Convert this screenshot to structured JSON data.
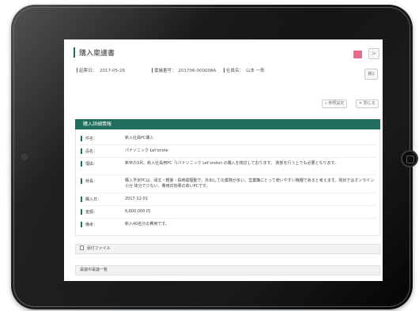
{
  "page": {
    "title": "購入稟議書",
    "meta": [
      {
        "label": "起票日：",
        "value": "2017-05-26"
      },
      {
        "label": "稟議番号：",
        "value": "201706-000008A"
      },
      {
        "label": "社員名：",
        "value": "山本 一郎"
      }
    ],
    "next_label": ">",
    "side_button_label": "我1",
    "tools": {
      "reference_label": "参照設定",
      "close_label": "閉じる"
    }
  },
  "detail": {
    "header": "購入詳細情報",
    "rows": [
      {
        "label": "件名：",
        "value": "新入社員PC購入"
      },
      {
        "label": "品名：",
        "value": "パナソニック Let'snote"
      },
      {
        "label": "理由：",
        "value": "新卒の3月、新入社員用PC「(パナソニック Let'snote) の購入を検討しております。 貴部を行う上でも必要となります。"
      },
      {
        "label": "特長：",
        "value": "購入予定PCは、頑丈・軽量・長時間駆動で、外出しての業務が多い、営業職にとって使いやすい機種であると考えます。現状ではオンライン小分 体分で少ない、費用対効果の高いPCです。"
      },
      {
        "label": "購入日：",
        "value": "2017-12-01"
      },
      {
        "label": "金額：",
        "value": "6,600,000 円"
      },
      {
        "label": "備考：",
        "value": "新入40名分の費用です。"
      }
    ]
  },
  "attachments": {
    "label": "添付ファイル"
  },
  "approvals": {
    "label": "稟議中稟議一覧"
  },
  "colors": {
    "accent": "#1f6f5c",
    "status": "#e86b8c"
  }
}
